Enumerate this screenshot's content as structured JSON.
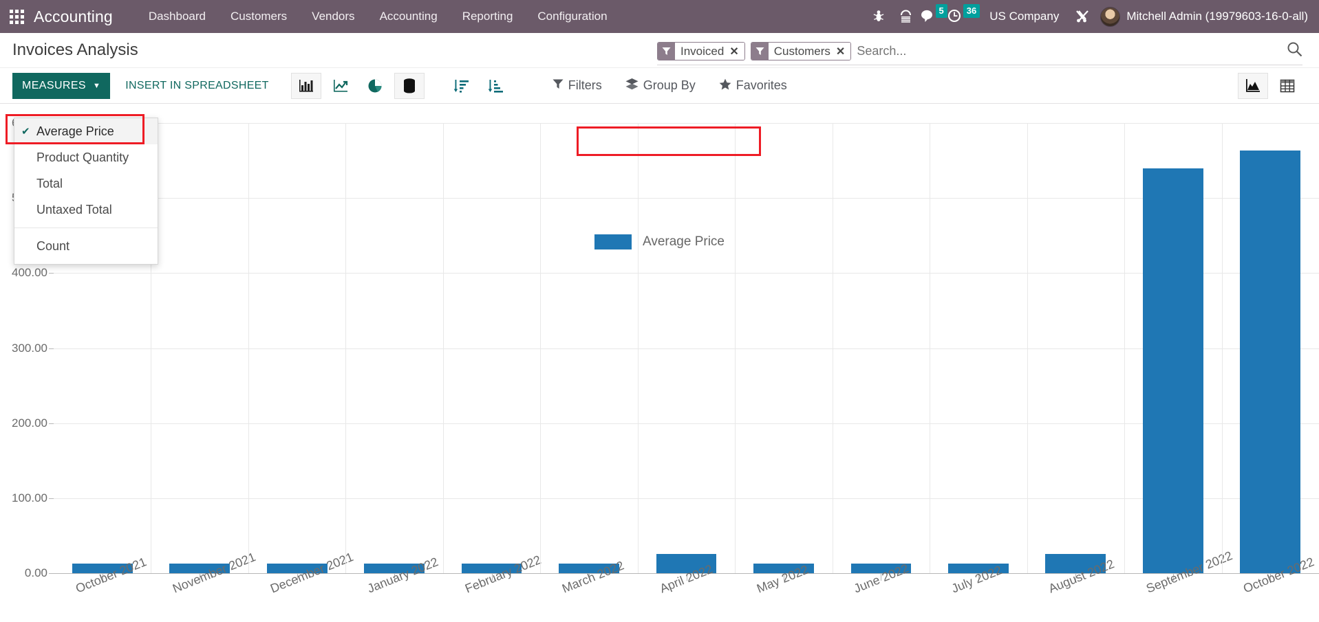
{
  "navbar": {
    "apps_icon": "apps-grid-icon",
    "brand": "Accounting",
    "menu": [
      "Dashboard",
      "Customers",
      "Vendors",
      "Accounting",
      "Reporting",
      "Configuration"
    ],
    "sys_icons": [
      {
        "name": "bug-icon",
        "glyph": "☣"
      },
      {
        "name": "phone-icon",
        "glyph": "☎"
      }
    ],
    "messages": {
      "icon": "messages-icon",
      "count": "5"
    },
    "activities": {
      "icon": "clock-icon",
      "count": "36"
    },
    "company": "US Company",
    "debug_icon": "tools-icon",
    "user": "Mitchell Admin (19979603-16-0-all)"
  },
  "control_panel": {
    "title": "Invoices Analysis",
    "search": {
      "placeholder": "Search...",
      "search_icon": "search-icon",
      "facets": [
        {
          "icon": "filter-icon",
          "label": "Invoiced",
          "remove": "✕"
        },
        {
          "icon": "filter-icon",
          "label": "Customers",
          "remove": "✕"
        }
      ]
    },
    "measures_label": "MEASURES",
    "insert_label": "INSERT IN SPREADSHEET",
    "chart_type_buttons": [
      {
        "name": "bar-chart-icon",
        "active": true
      },
      {
        "name": "line-chart-icon",
        "active": false
      },
      {
        "name": "pie-chart-icon",
        "active": false
      },
      {
        "name": "stacked-icon",
        "active": true
      }
    ],
    "sort_buttons": [
      {
        "name": "sort-descending-icon"
      },
      {
        "name": "sort-ascending-icon"
      }
    ],
    "menus": [
      {
        "name": "filters-menu",
        "icon": "filter-icon",
        "label": "Filters"
      },
      {
        "name": "group-by-menu",
        "icon": "layers-icon",
        "label": "Group By"
      },
      {
        "name": "favorites-menu",
        "icon": "star-icon",
        "label": "Favorites"
      }
    ],
    "view_switcher": [
      {
        "name": "graph-view-icon",
        "active": true
      },
      {
        "name": "list-view-icon",
        "active": false
      }
    ]
  },
  "measures_menu": {
    "items": [
      {
        "label": "Average Price",
        "checked": true
      },
      {
        "label": "Product Quantity",
        "checked": false
      },
      {
        "label": "Total",
        "checked": false
      },
      {
        "label": "Untaxed Total",
        "checked": false
      }
    ],
    "separator_after": 3,
    "count_item": {
      "label": "Count",
      "checked": false
    },
    "check_glyph": "✔",
    "highlight_color": "#ee1c25"
  },
  "chart_data": {
    "type": "bar",
    "title": "",
    "xlabel": "",
    "ylabel": "",
    "legend": {
      "position": "top-center",
      "entries": [
        "Average Price"
      ]
    },
    "series_color": "#1f77b4",
    "grid": true,
    "ylim": [
      0,
      600
    ],
    "yticks": [
      0,
      100,
      200,
      300,
      400,
      500,
      600
    ],
    "ytick_labels": [
      "0.00",
      "100.00",
      "200.00",
      "300.00",
      "400.00",
      "500.00",
      "600.00"
    ],
    "categories": [
      "October 2021",
      "November 2021",
      "December 2021",
      "January 2022",
      "February 2022",
      "March 2022",
      "April 2022",
      "May 2022",
      "June 2022",
      "July 2022",
      "August 2022",
      "September 2022",
      "October 2022"
    ],
    "series": [
      {
        "name": "Average Price",
        "values": [
          13,
          13,
          13,
          13,
          13,
          13,
          26,
          13,
          13,
          13,
          26,
          540,
          563
        ]
      }
    ]
  }
}
